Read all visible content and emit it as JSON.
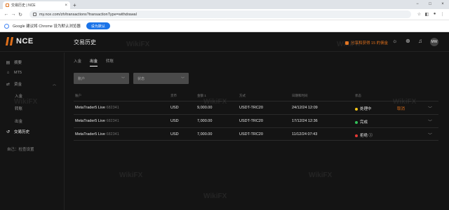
{
  "browser": {
    "tab_title": "交易历史 | NCE",
    "tab_close": "×",
    "new_tab": "+",
    "url": "my.nce.com/zh/transactions?transactionType=withdrawal",
    "window_controls": [
      "−",
      "□",
      "×"
    ]
  },
  "infobar": {
    "message": "Google 建议将 Chrome 设为默认浏览器",
    "button_label": "设为默认"
  },
  "header": {
    "logo_text": "NCE",
    "page_title": "交易历史",
    "promo_text": "分享和获得 15 的佣金",
    "avatar_text": "MW"
  },
  "sidebar": {
    "items": [
      {
        "label": "摘要",
        "icon": "summary-icon"
      },
      {
        "label": "MT5",
        "icon": "mt5-icon"
      },
      {
        "label": "资金",
        "icon": "funds-icon"
      },
      {
        "label": "入金"
      },
      {
        "label": "转账"
      },
      {
        "label": "出金"
      },
      {
        "label": "交易历史",
        "icon": "history-icon"
      }
    ],
    "bottom_link": "自己：检查设置"
  },
  "tabs": [
    {
      "label": "入金",
      "active": false
    },
    {
      "label": "出金",
      "active": true
    },
    {
      "label": "转账",
      "active": false
    }
  ],
  "filters": [
    {
      "placeholder": "账户"
    },
    {
      "placeholder": "状态"
    }
  ],
  "table": {
    "headers": [
      "账户",
      "货币",
      "金额 1",
      "方式",
      "日期和时间",
      "状态"
    ],
    "rows": [
      {
        "account": "MetaTrader5 Live",
        "account_id": "682341",
        "currency": "USD",
        "amount": "9,000.00",
        "method": "USDT-TRC20",
        "datetime": "24/12/24 12:09",
        "status": "处理中",
        "status_color": "#f5c518",
        "action": "取消"
      },
      {
        "account": "MetaTrader5 Live",
        "account_id": "682341",
        "currency": "USD",
        "amount": "7,000.00",
        "method": "USDT-TRC20",
        "datetime": "17/12/24 12:36",
        "status": "完成",
        "status_color": "#33c15a",
        "action": ""
      },
      {
        "account": "MetaTrader5 Live",
        "account_id": "682341",
        "currency": "USD",
        "amount": "7,000.00",
        "method": "USDT-TRC20",
        "datetime": "11/12/24 07:43",
        "status": "拒绝 ⓘ",
        "status_color": "#e53935",
        "action": ""
      }
    ]
  },
  "watermark": "WikiFX",
  "colors": {
    "accent": "#e0701b",
    "background": "#141414"
  }
}
